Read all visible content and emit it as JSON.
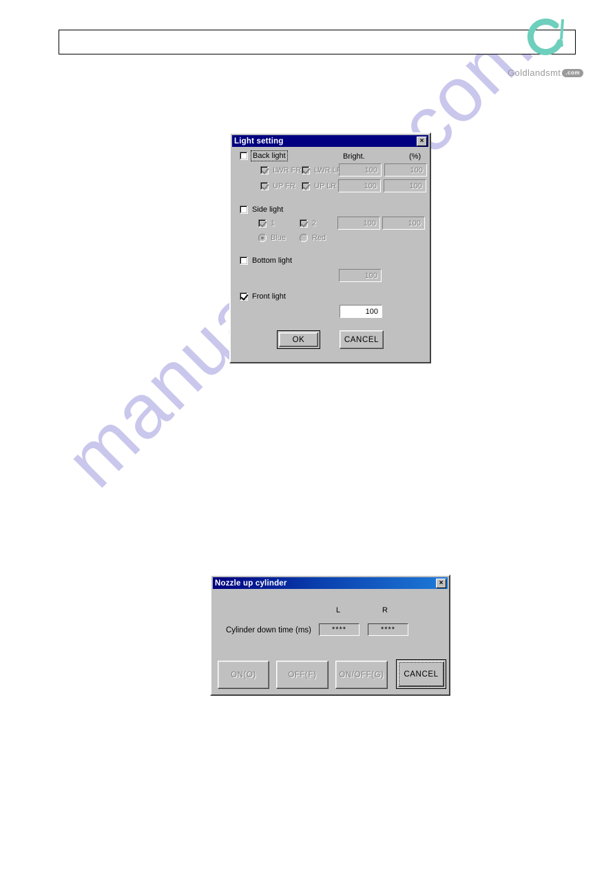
{
  "page": {
    "watermark": "manualshive.com"
  },
  "header": {
    "box_label": "",
    "brand_name": "Goldlandsmt",
    "brand_badge": ".com",
    "brand_color": "#6ecfbd",
    "brand_text_color": "#9a9a9a"
  },
  "light_dialog": {
    "title": "Light setting",
    "close_label": "×",
    "titlebar_color": "#000080",
    "columns": {
      "bright_label": "Bright.",
      "percent_label": "(%)"
    },
    "back_light": {
      "label": "Back light",
      "checked": false,
      "sub_checkboxes": [
        {
          "label": "LWR FR",
          "checked": true
        },
        {
          "label": "LWR LR",
          "checked": true
        },
        {
          "label": "UP FR",
          "checked": true
        },
        {
          "label": "UP LR",
          "checked": true
        }
      ],
      "values": [
        {
          "value": "100"
        },
        {
          "value": "100"
        },
        {
          "value": "100"
        },
        {
          "value": "100"
        }
      ]
    },
    "side_light": {
      "label": "Side light",
      "checked": false,
      "sub_checkboxes": [
        {
          "label": "1",
          "checked": true
        },
        {
          "label": "2",
          "checked": true
        }
      ],
      "radios": [
        {
          "label": "Blue",
          "selected": true
        },
        {
          "label": "Red",
          "selected": false
        }
      ],
      "values": [
        {
          "value": "100"
        },
        {
          "value": "100"
        }
      ]
    },
    "bottom_light": {
      "label": "Bottom light",
      "checked": false,
      "value": "100"
    },
    "front_light": {
      "label": "Front light",
      "checked": true,
      "value": "100"
    },
    "buttons": {
      "ok": "OK",
      "cancel": "CANCEL"
    }
  },
  "nozzle_dialog": {
    "title": "Nozzle up cylinder",
    "close_label": "×",
    "column_headers": {
      "left": "L",
      "right": "R"
    },
    "row_label": "Cylinder down time (ms)",
    "values": {
      "left": "****",
      "right": "****"
    },
    "buttons": [
      {
        "label": "ON(O)",
        "enabled": false
      },
      {
        "label": "OFF(F)",
        "enabled": false
      },
      {
        "label": "ON/OFF(G)",
        "enabled": false
      },
      {
        "label": "CANCEL",
        "enabled": true
      }
    ]
  }
}
